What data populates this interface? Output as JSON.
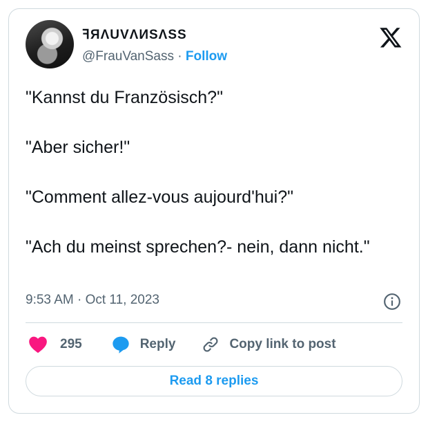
{
  "author": {
    "display_name": "ꟻЯΛUVΛИSΛSS",
    "handle": "@FrauVanSass",
    "separator": "·",
    "follow_label": "Follow"
  },
  "tweet": {
    "lines": [
      "\"Kannst du Französisch?\"",
      "\"Aber sicher!\"",
      "\"Comment allez-vous aujourd'hui?\"",
      "\"Ach du meinst sprechen?- nein, dann nicht.\""
    ],
    "timestamp": "9:53 AM · Oct 11, 2023"
  },
  "actions": {
    "like_count": "295",
    "reply_label": "Reply",
    "copy_label": "Copy link to post"
  },
  "read_replies_label": "Read 8 replies",
  "colors": {
    "accent": "#1d9bf0",
    "like": "#f91880",
    "text": "#0f1419",
    "secondary": "#536471",
    "border": "#cfd9de"
  },
  "icons": [
    "x-logo-icon",
    "info-icon",
    "heart-icon",
    "reply-bubble-icon",
    "link-icon"
  ]
}
